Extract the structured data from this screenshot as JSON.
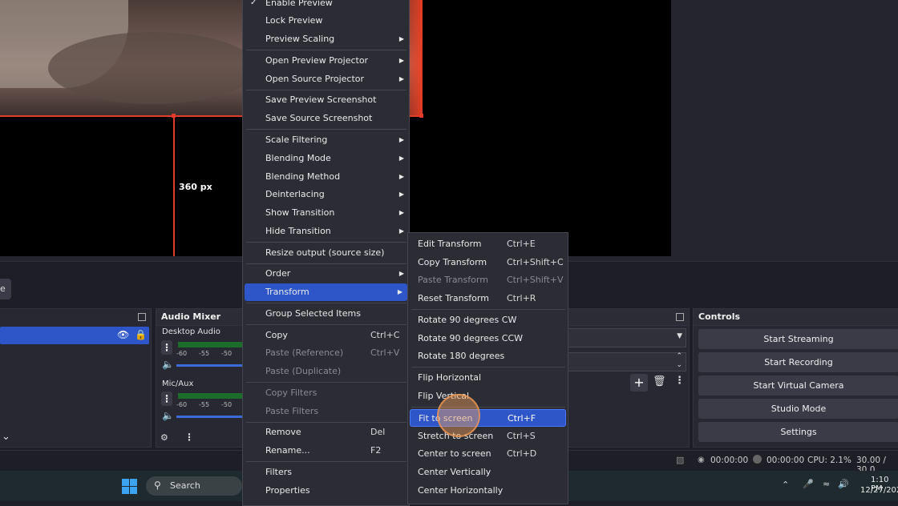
{
  "preview": {
    "guide_label": "360 px"
  },
  "scene_tab": {
    "label": "e"
  },
  "panels": {
    "audio_mixer_title": "Audio Mixer",
    "controls_title": "Controls",
    "tracks": [
      {
        "name": "Desktop Audio",
        "scale": [
          "-60",
          "-55",
          "-50"
        ]
      },
      {
        "name": "Mic/Aux",
        "scale": [
          "-60",
          "-55",
          "-50"
        ]
      }
    ]
  },
  "controls": {
    "start_streaming": "Start Streaming",
    "start_recording": "Start Recording",
    "start_virtual_camera": "Start Virtual Camera",
    "studio_mode": "Studio Mode",
    "settings": "Settings"
  },
  "status": {
    "rec_time": "00:00:00",
    "stream_time": "00:00:00",
    "cpu": "CPU: 2.1%",
    "fps": "30.00 / 30.0"
  },
  "taskbar": {
    "search_label": "Search",
    "time": "1:10 PM",
    "date": "12/27/202"
  },
  "context_menu": {
    "items": [
      {
        "label": "Enable Preview",
        "checked": true
      },
      {
        "label": "Lock Preview"
      },
      {
        "label": "Preview Scaling",
        "submenu": true
      },
      {
        "label": "Open Preview Projector",
        "submenu": true
      },
      {
        "label": "Open Source Projector",
        "submenu": true
      },
      {
        "label": "Save Preview Screenshot"
      },
      {
        "label": "Save Source Screenshot"
      },
      {
        "label": "Scale Filtering",
        "submenu": true
      },
      {
        "label": "Blending Mode",
        "submenu": true
      },
      {
        "label": "Blending Method",
        "submenu": true
      },
      {
        "label": "Deinterlacing",
        "submenu": true
      },
      {
        "label": "Show Transition",
        "submenu": true
      },
      {
        "label": "Hide Transition",
        "submenu": true
      },
      {
        "label": "Resize output (source size)"
      },
      {
        "label": "Order",
        "submenu": true
      },
      {
        "label": "Transform",
        "submenu": true,
        "highlighted": true
      },
      {
        "label": "Group Selected Items"
      },
      {
        "label": "Copy",
        "shortcut": "Ctrl+C"
      },
      {
        "label": "Paste (Reference)",
        "shortcut": "Ctrl+V",
        "disabled": true
      },
      {
        "label": "Paste (Duplicate)",
        "disabled": true
      },
      {
        "label": "Copy Filters",
        "disabled": true
      },
      {
        "label": "Paste Filters",
        "disabled": true
      },
      {
        "label": "Remove",
        "shortcut": "Del"
      },
      {
        "label": "Rename...",
        "shortcut": "F2"
      },
      {
        "label": "Filters"
      },
      {
        "label": "Properties"
      }
    ]
  },
  "transform_submenu": {
    "items": [
      {
        "label": "Edit Transform",
        "shortcut": "Ctrl+E"
      },
      {
        "label": "Copy Transform",
        "shortcut": "Ctrl+Shift+C"
      },
      {
        "label": "Paste Transform",
        "shortcut": "Ctrl+Shift+V",
        "disabled": true
      },
      {
        "label": "Reset Transform",
        "shortcut": "Ctrl+R"
      },
      {
        "label": "Rotate 90 degrees CW"
      },
      {
        "label": "Rotate 90 degrees CCW"
      },
      {
        "label": "Rotate 180 degrees"
      },
      {
        "label": "Flip Horizontal"
      },
      {
        "label": "Flip Vertical"
      },
      {
        "label": "Fit to screen",
        "shortcut": "Ctrl+F",
        "highlighted": true
      },
      {
        "label": "Stretch to screen",
        "shortcut": "Ctrl+S"
      },
      {
        "label": "Center to screen",
        "shortcut": "Ctrl+D"
      },
      {
        "label": "Center Vertically"
      },
      {
        "label": "Center Horizontally"
      }
    ]
  }
}
